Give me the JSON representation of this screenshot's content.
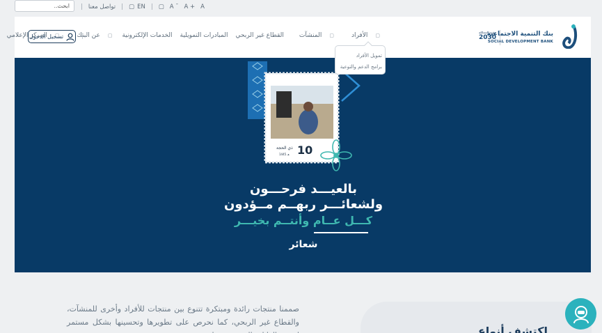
{
  "topbar": {
    "search_placeholder": "ابحث..",
    "contact": "تواصل معنا",
    "lang": "EN",
    "lang_icon": "globe-icon",
    "font_size_icon": "accessibility-icon",
    "font_controls": [
      "A",
      "A ˉ",
      "A +"
    ]
  },
  "header": {
    "logo_ar": "بنك التنمية الاجتماعية",
    "logo_en": "SOCIAL DEVELOPMENT BANK",
    "vision": "2030",
    "vision_small": "رؤية المملكة",
    "nav": [
      {
        "label": "الأفراد",
        "has_dropdown": true
      },
      {
        "label": "المنشآت",
        "has_dropdown": true
      },
      {
        "label": "القطاع غير الربحي",
        "has_dropdown": false
      },
      {
        "label": "المبادرات التمويلية",
        "has_dropdown": false
      },
      {
        "label": "الخدمات الإلكترونية",
        "has_dropdown": false
      },
      {
        "label": "عن البنك",
        "has_dropdown": true
      },
      {
        "label": "المركز الإعلامي",
        "has_dropdown": true
      }
    ],
    "login": "تسجيل الدخول"
  },
  "dropdown": {
    "items": [
      "تمويل الأفراد",
      "برامج الدعم والتوعية"
    ]
  },
  "banner": {
    "line1": "بالعيـــد فرحـــون",
    "line2": "ولشعائـــر ربهــم مــؤدون",
    "line3": "كـــل عــام وأنتــم بخيـــر",
    "logo": "شعائر",
    "stamp_date": "10",
    "stamp_month": "ذي الحجة",
    "stamp_year": "1445 هـ",
    "colors": {
      "bg": "#083a66",
      "accent": "#3fb8b0"
    }
  },
  "content": {
    "intro": "صممنا منتجات رائدة ومبتكرة تتنوع بين منتجات للأفراد وأخرى للمنشآت، والقطاع غير الربحي، كما نحرص على تطويرها وتحسينها بشكل مستمر لتحقق الغايات المرجوة منها.",
    "card_title": "اكتشف أنواع"
  }
}
